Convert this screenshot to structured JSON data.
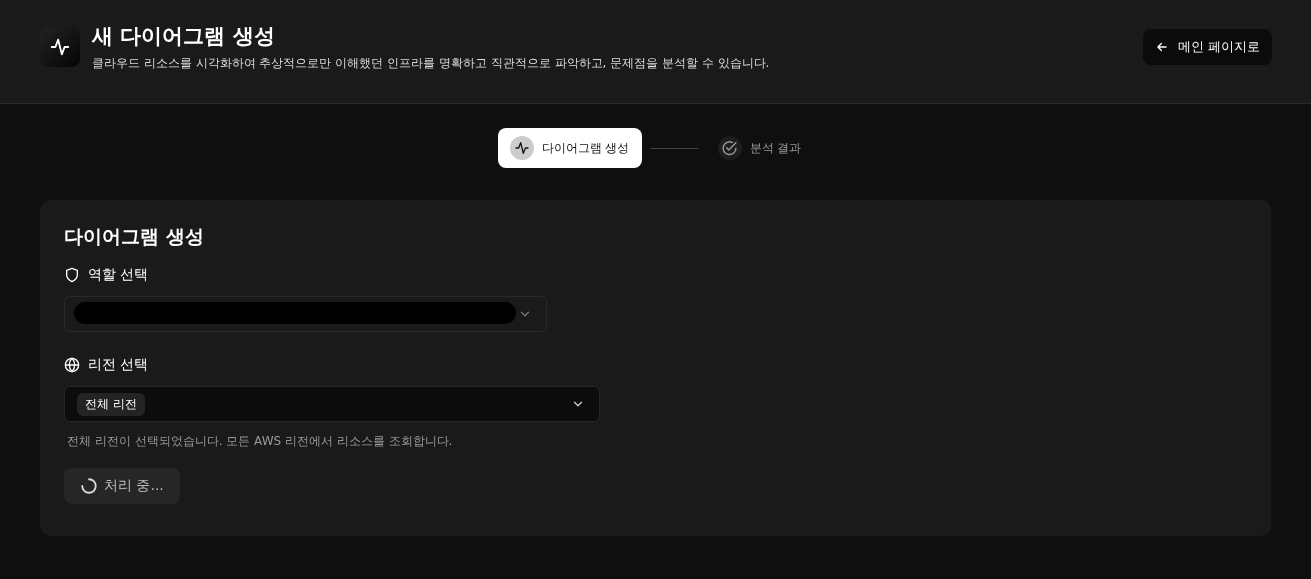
{
  "header": {
    "title": "새 다이어그램 생성",
    "subtitle": "클라우드 리소스를 시각화하여 추상적으로만 이해했던 인프라를 명확하고 직관적으로 파악하고, 문제점을 분석할 수 있습니다.",
    "back_button": "메인 페이지로"
  },
  "steps": [
    {
      "label": "다이어그램 생성",
      "selected": true,
      "kind": "pulse"
    },
    {
      "label": "분석 결과",
      "selected": false,
      "kind": "check"
    }
  ],
  "card": {
    "title": "다이어그램 생성",
    "role": {
      "label": "역할 선택",
      "redacted": true
    },
    "region": {
      "label": "리전 선택",
      "chip": "전체 리전",
      "hint": "전체 리전이 선택되었습니다. 모든 AWS 리전에서 리소스를 조회합니다."
    },
    "submit": {
      "label": "처리 중...",
      "loading": true
    }
  }
}
